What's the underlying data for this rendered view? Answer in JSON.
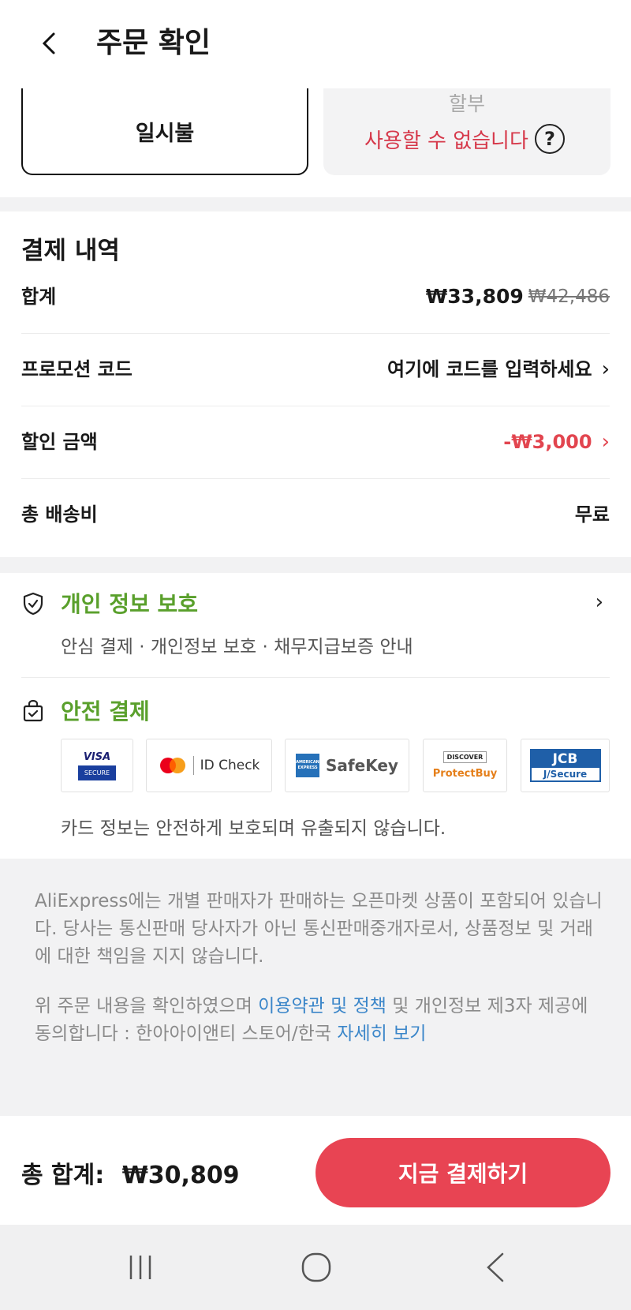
{
  "header": {
    "title": "주문 확인",
    "back_icon": "chevron-left-icon"
  },
  "installment": {
    "option1": "일시불",
    "option2_title": "할부",
    "option2_status": "사용할 수 없습니다",
    "help_icon": "question-circle-icon"
  },
  "summary": {
    "title": "결제 내역",
    "rows": [
      {
        "label": "합계",
        "price": "₩33,809",
        "old_price": "₩42,486"
      },
      {
        "label": "프로모션 코드",
        "value": "여기에 코드를 입력하세요"
      },
      {
        "label": "할인 금액",
        "value": "-₩3,000"
      },
      {
        "label": "총 배송비",
        "value": "무료"
      }
    ]
  },
  "privacy": {
    "title": "개인 정보 보호",
    "subtitle": "안심 결제 · 개인정보 보호 · 채무지급보증 안내"
  },
  "secure": {
    "title": "안전 결제",
    "note": "카드 정보는 안전하게 보호되며 유출되지 않습니다.",
    "badges": {
      "visa_top": "VISA",
      "visa_bottom": "SECURE",
      "mc": "ID Check",
      "amex": "SafeKey",
      "amex_logo": "AMERICAN EXPRESS",
      "discover_top": "DISCOVER",
      "discover_bottom": "ProtectBuy",
      "jcb_top": "JCB",
      "jcb_bottom": "J/Secure"
    }
  },
  "legal": {
    "p1": "AliExpress에는 개별 판매자가 판매하는 오픈마켓 상품이 포함되어 있습니다. 당사는 통신판매 당사자가 아닌 통신판매중개자로서, 상품정보 및 거래에 대한 책임을 지지 않습니다.",
    "p2_a": "위 주문 내용을 확인하였으며 ",
    "p2_link1": "이용약관 및 정책",
    "p2_b": " 및 개인정보 제3자 제공에 동의합니다 : 한아아이앤티 스토어/한국 ",
    "p2_link2": "자세히 보기"
  },
  "footer": {
    "total_label": "총 합계:",
    "total_value": "₩30,809",
    "pay_button": "지금 결제하기"
  },
  "colors": {
    "accent": "#e84453",
    "green": "#5aa02c",
    "link": "#3b86c9"
  }
}
